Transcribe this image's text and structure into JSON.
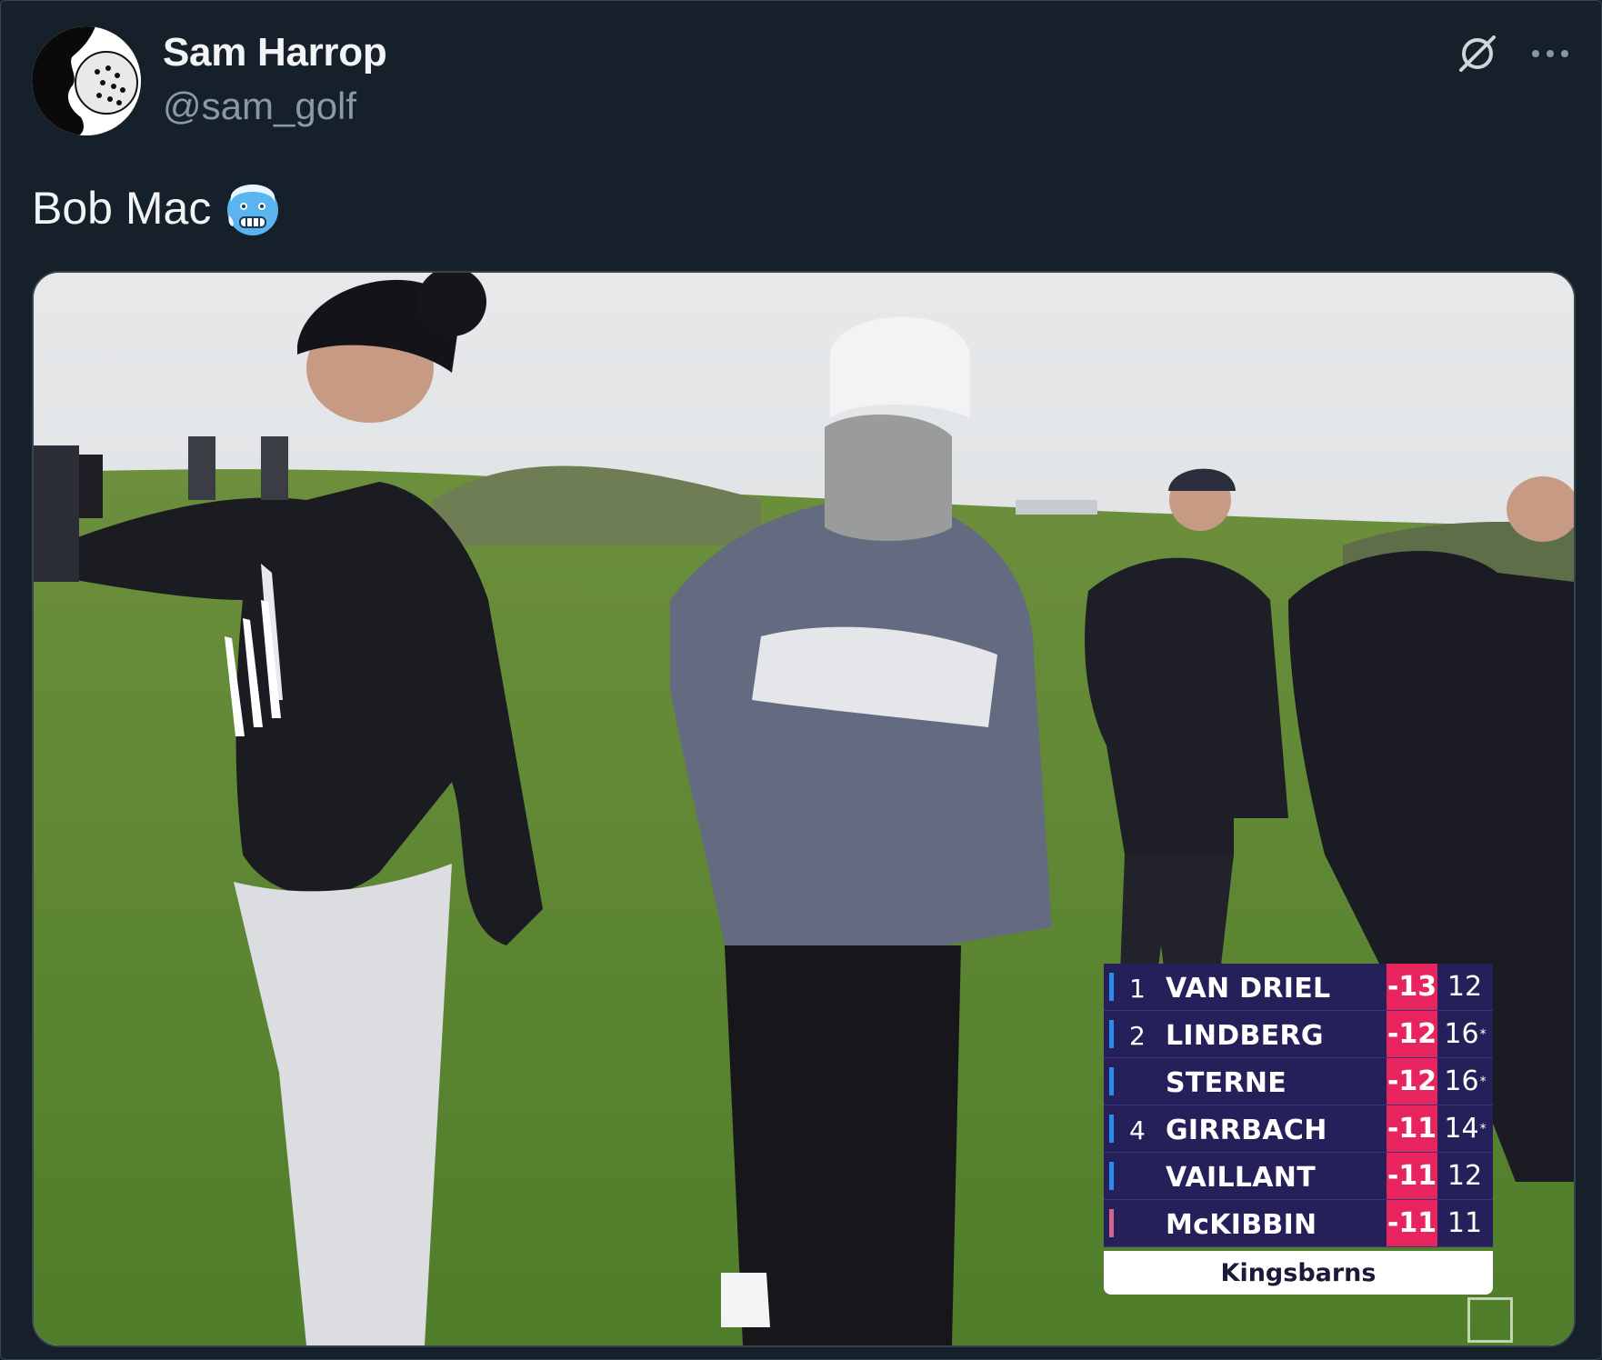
{
  "tweet": {
    "author_name": "Sam Harrop",
    "author_handle": "@sam_golf",
    "text": "Bob Mac",
    "emoji_icon": "cold-face-emoji"
  },
  "leaderboard": {
    "rows": [
      {
        "pos": "1",
        "player": "VAN DRIEL",
        "score": "-13",
        "thru": "12",
        "star": "",
        "bar_color": "#2a8ce8"
      },
      {
        "pos": "2",
        "player": "LINDBERG",
        "score": "-12",
        "thru": "16",
        "star": "*",
        "bar_color": "#2a8ce8"
      },
      {
        "pos": "",
        "player": "STERNE",
        "score": "-12",
        "thru": "16",
        "star": "*",
        "bar_color": "#2a8ce8"
      },
      {
        "pos": "4",
        "player": "GIRRBACH",
        "score": "-11",
        "thru": "14",
        "star": "*",
        "bar_color": "#2a8ce8"
      },
      {
        "pos": "",
        "player": "VAILLANT",
        "score": "-11",
        "thru": "12",
        "star": "",
        "bar_color": "#2a8ce8"
      },
      {
        "pos": "",
        "player": "McKIBBIN",
        "score": "-11",
        "thru": "11",
        "star": "",
        "bar_color": "#d6628e"
      }
    ],
    "course": "Kingsbarns"
  },
  "colors": {
    "background": "#15202b",
    "score_badge": "#e8245f",
    "leaderboard_bg": "#26205a"
  }
}
